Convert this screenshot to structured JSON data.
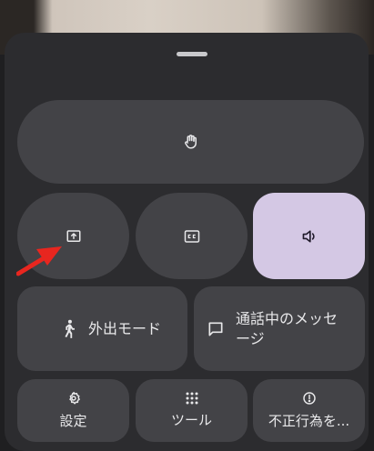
{
  "bottom_sheet": {
    "raise_hand": {
      "icon": "hand-icon"
    },
    "share_screen": {
      "icon": "present-screen-icon"
    },
    "captions": {
      "icon": "closed-captions-icon"
    },
    "audio": {
      "icon": "speaker-icon",
      "active_color": "#d4c8e4"
    },
    "companion_mode": {
      "label": "外出モード",
      "icon": "walking-person-icon"
    },
    "in_call_messages": {
      "label": "通話中のメッセージ",
      "icon": "chat-bubble-icon"
    },
    "settings": {
      "label": "設定",
      "icon": "gear-icon"
    },
    "tools": {
      "label": "ツール",
      "icon": "grid-dots-icon"
    },
    "report_abuse": {
      "label": "不正行為を...",
      "icon": "alert-circle-icon"
    }
  },
  "annotation": {
    "arrow_color": "#e8261f"
  }
}
